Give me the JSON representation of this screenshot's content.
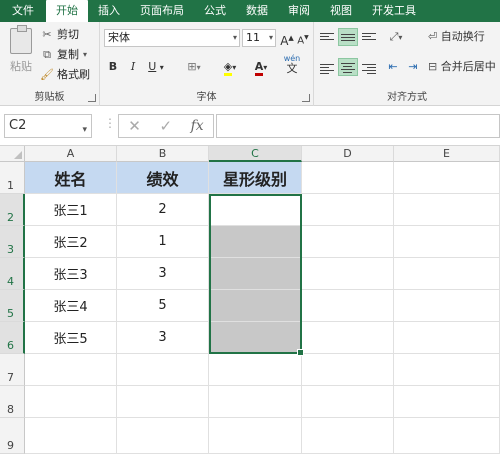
{
  "ribbon": {
    "tabs": [
      "文件",
      "开始",
      "插入",
      "页面布局",
      "公式",
      "数据",
      "审阅",
      "视图",
      "开发工具"
    ],
    "active_tab": "开始",
    "clipboard": {
      "paste_label": "粘贴",
      "cut_label": "剪切",
      "copy_label": "复制",
      "format_painter_label": "格式刷",
      "group_label": "剪贴板"
    },
    "font": {
      "font_name": "宋体",
      "font_size": "11",
      "grow_label": "A",
      "shrink_label": "A",
      "bold_label": "B",
      "italic_label": "I",
      "underline_label": "U",
      "font_color_label": "A",
      "phonetic_label": "wén",
      "group_label": "字体"
    },
    "alignment": {
      "wrap_text_label": "自动换行",
      "merge_center_label": "合并后居中",
      "group_label": "对齐方式"
    }
  },
  "formula_bar": {
    "name_box": "C2",
    "cancel_icon": "✕",
    "enter_icon": "✓",
    "fx_label": "fx",
    "formula_value": ""
  },
  "sheet": {
    "columns": [
      "A",
      "B",
      "C",
      "D",
      "E"
    ],
    "selected_column": "C",
    "rows": [
      "1",
      "2",
      "3",
      "4",
      "5",
      "6",
      "7",
      "8",
      "9"
    ],
    "selected_rows": [
      "2",
      "3",
      "4",
      "5",
      "6"
    ],
    "headers": {
      "a": "姓名",
      "b": "绩效",
      "c": "星形级别"
    },
    "data": [
      {
        "name": "张三1",
        "score": "2",
        "stars": ""
      },
      {
        "name": "张三2",
        "score": "1",
        "stars": ""
      },
      {
        "name": "张三3",
        "score": "3",
        "stars": ""
      },
      {
        "name": "张三4",
        "score": "5",
        "stars": ""
      },
      {
        "name": "张三5",
        "score": "3",
        "stars": ""
      }
    ],
    "active_cell": "C2",
    "selection": "C2:C6"
  },
  "colors": {
    "excel_green": "#217346",
    "header_fill": "#c5d9f1",
    "gray_fill": "#c8c8c8"
  }
}
